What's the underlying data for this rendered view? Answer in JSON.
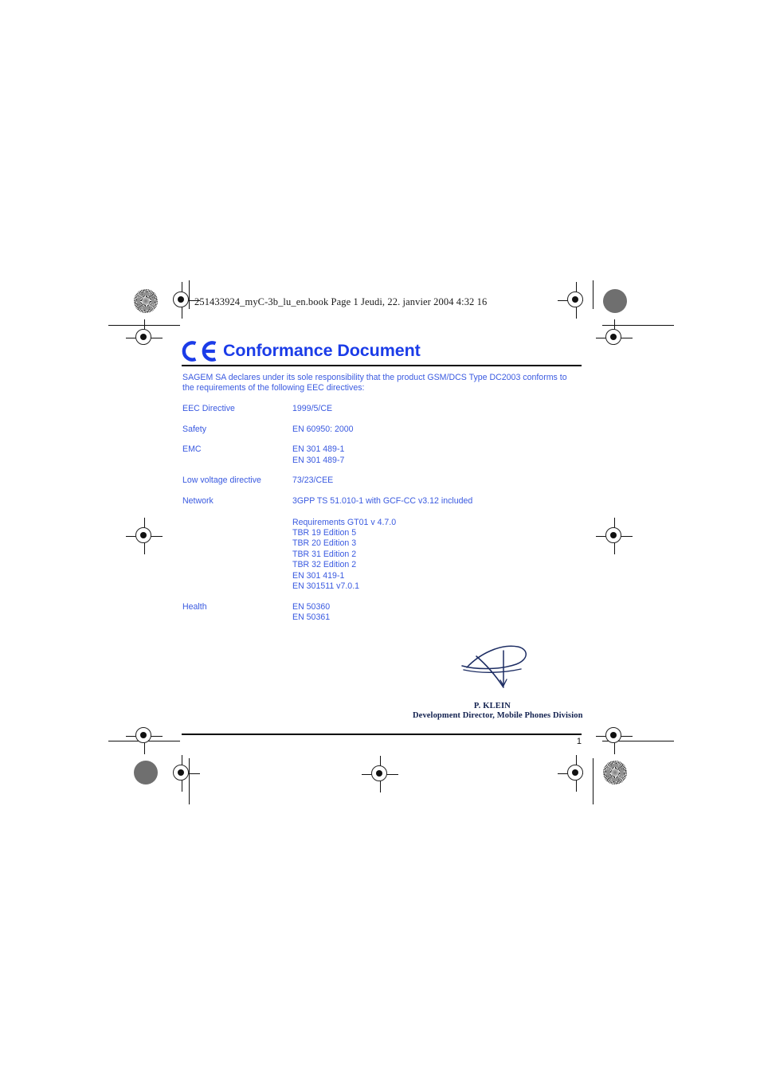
{
  "page": {
    "slug_line": "251433924_myC-3b_lu_en.book  Page 1  Jeudi, 22. janvier 2004  4:32 16",
    "page_number": "1",
    "accent_blue": "#1b3ce8",
    "body_blue": "#3a5ae0",
    "signature_navy": "#12214f"
  },
  "title": {
    "text": "Conformance Document",
    "ce_mark": "ce-marking-icon"
  },
  "intro": {
    "text": "SAGEM SA declares under its sole responsibility that the product GSM/DCS Type DC2003 conforms to the requirements of the following EEC directives:"
  },
  "specs": [
    {
      "label": "EEC Directive",
      "values": [
        "1999/5/CE"
      ]
    },
    {
      "label": "Safety",
      "values": [
        "EN 60950: 2000"
      ]
    },
    {
      "label": "EMC",
      "values": [
        "EN 301 489-1",
        "EN 301 489-7"
      ]
    },
    {
      "label": "Low voltage directive",
      "values": [
        "73/23/CEE"
      ]
    },
    {
      "label": "Network",
      "values": [
        "3GPP TS 51.010-1 with GCF-CC v3.12 included",
        "Requirements GT01 v 4.7.0",
        "TBR 19 Edition 5",
        "TBR 20 Edition 3",
        "TBR 31 Edition 2",
        "TBR 32 Edition 2",
        "EN 301 419-1",
        "EN 301511 v7.0.1"
      ],
      "gap_before_index": 1
    },
    {
      "label": "Health",
      "values": [
        "EN 50360",
        "EN 50361"
      ]
    }
  ],
  "signature": {
    "name": "P. KLEIN",
    "role": "Development Director, Mobile Phones Division"
  },
  "prepress": {
    "registration_mark": "registration-target-icon",
    "halftone_solid": "halftone-solid-dot",
    "halftone_burst": "halftone-starburst-target"
  }
}
